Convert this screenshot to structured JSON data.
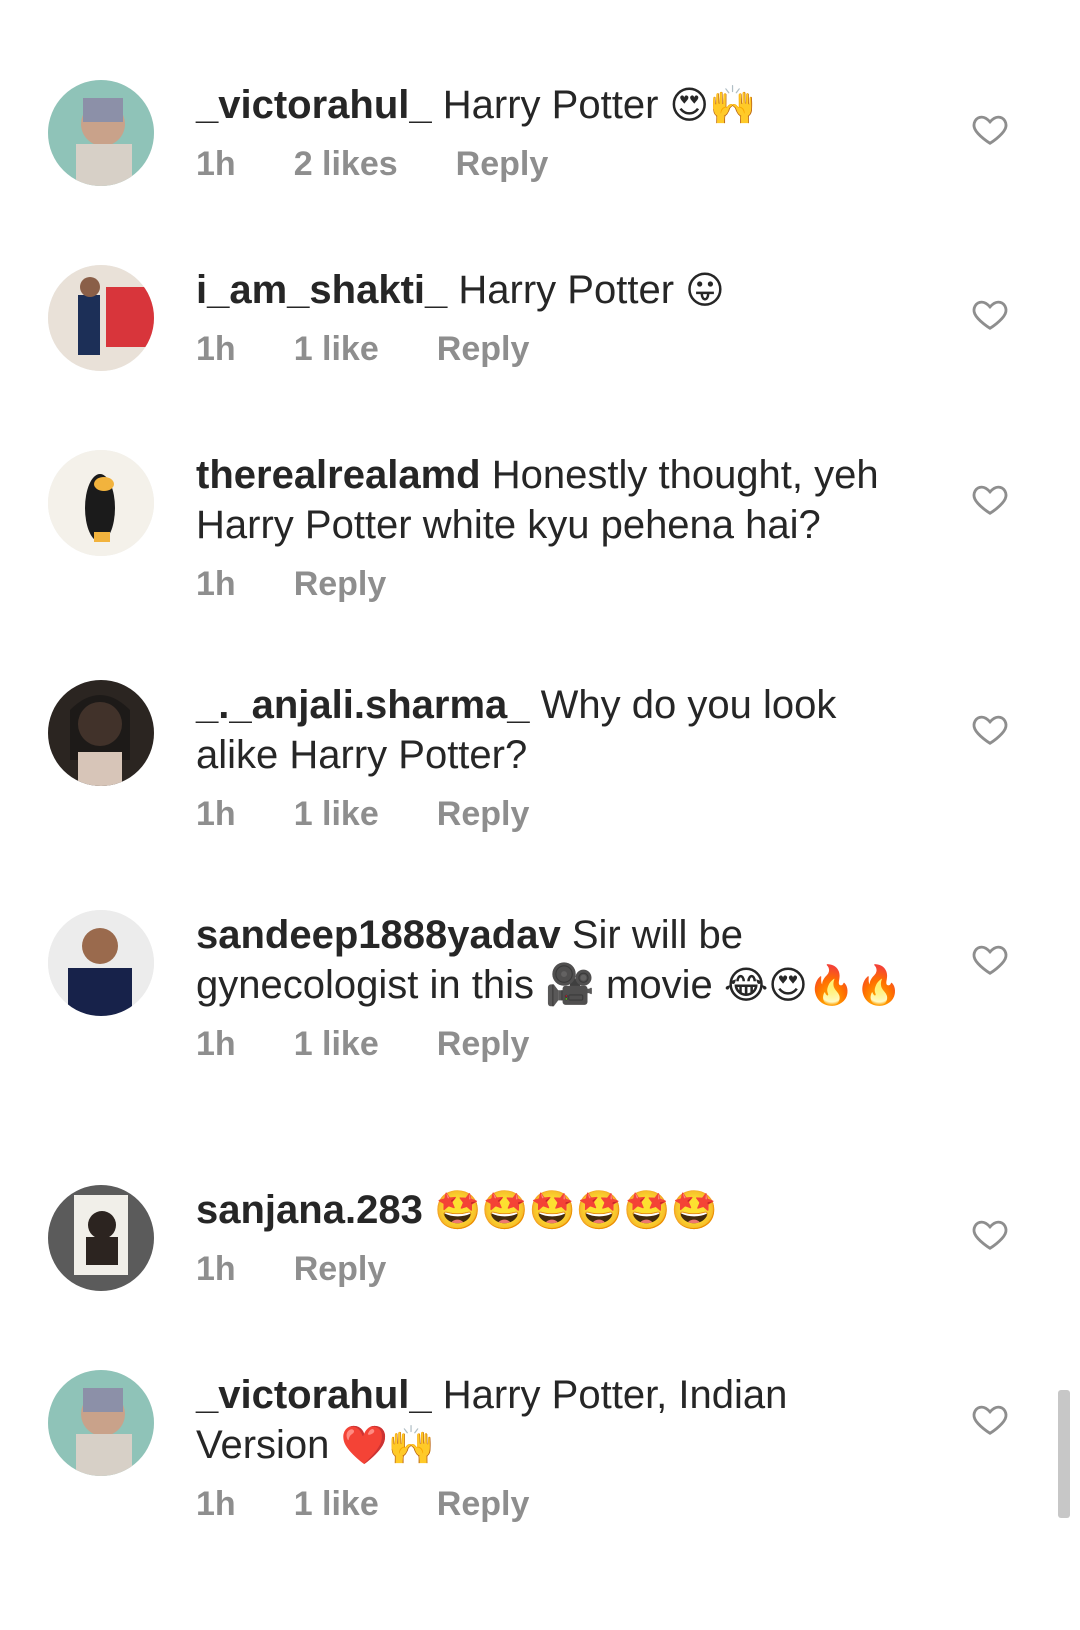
{
  "comments": [
    {
      "username": "_victorahul_",
      "text": "Harry Potter",
      "emoji": "😍🙌",
      "time": "1h",
      "likes": "2 likes",
      "reply": "Reply"
    },
    {
      "username": "i_am_shakti_",
      "text": "Harry Potter",
      "emoji": "😛",
      "time": "1h",
      "likes": "1 like",
      "reply": "Reply"
    },
    {
      "username": "therealrealamd",
      "text": "Honestly thought, yeh Harry Potter white kyu pehena hai?",
      "emoji": "",
      "time": "1h",
      "likes": "",
      "reply": "Reply"
    },
    {
      "username": "_._anjali.sharma_",
      "text": "Why do you look alike Harry Potter?",
      "emoji": "",
      "time": "1h",
      "likes": "1 like",
      "reply": "Reply"
    },
    {
      "username": "sandeep1888yadav",
      "text": "Sir will be gynecologist in this 🎥  movie",
      "emoji": "😂😍🔥🔥",
      "time": "1h",
      "likes": "1 like",
      "reply": "Reply"
    },
    {
      "username": "sanjana.283",
      "text": "",
      "emoji": "🤩🤩🤩🤩🤩🤩",
      "time": "1h",
      "likes": "",
      "reply": "Reply"
    },
    {
      "username": "_victorahul_",
      "text": "Harry Potter, Indian Version",
      "emoji": "❤️🙌",
      "time": "1h",
      "likes": "1 like",
      "reply": "Reply"
    }
  ],
  "icons": {
    "like": "heart-outline-icon"
  },
  "colors": {
    "text": "#262626",
    "meta": "#8e8e8e",
    "heart": "#8e8e8e"
  }
}
